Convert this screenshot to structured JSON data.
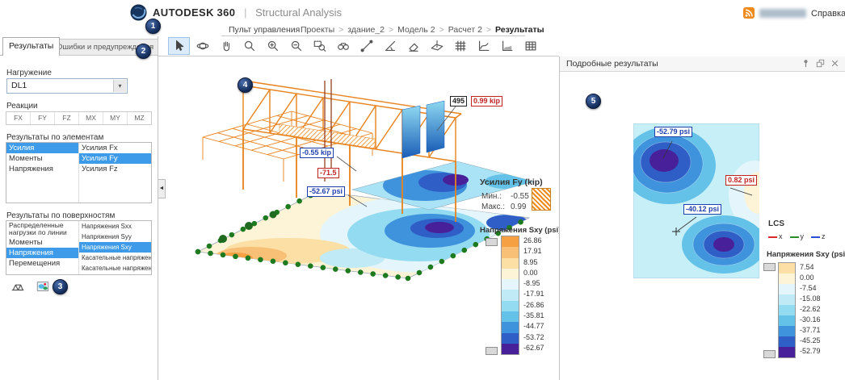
{
  "header": {
    "brand": "AUTODESK",
    "brand_sup": "360",
    "divider": "|",
    "app_title": "Structural Analysis",
    "help_link": "Справка",
    "nav_home": "Пульт управления",
    "breadcrumb_sep": ">",
    "breadcrumbs": [
      "Проекты",
      "здание_2",
      "Модель 2",
      "Расчет 2",
      "Результаты"
    ]
  },
  "tabs": {
    "results": "Результаты",
    "errors": "Ошибки и предупреждения"
  },
  "left_panel": {
    "load_label": "Нагружение",
    "load_value": "DL1",
    "reactions_label": "Реакции",
    "reaction_buttons": [
      "FX",
      "FY",
      "FZ",
      "MX",
      "MY",
      "MZ"
    ],
    "element_results_label": "Результаты по элементам",
    "element_categories": [
      {
        "label": "Усилия",
        "selected": true
      },
      {
        "label": "Моменты",
        "selected": false
      },
      {
        "label": "Напряжения",
        "selected": false
      }
    ],
    "element_items": [
      {
        "label": "Усилия Fx",
        "selected": false
      },
      {
        "label": "Усилия Fy",
        "selected": true
      },
      {
        "label": "Усилия Fz",
        "selected": false
      }
    ],
    "surface_results_label": "Результаты по поверхностям",
    "surface_categories": [
      {
        "label": "Распределенные нагрузки по линии",
        "selected": false
      },
      {
        "label": "Моменты",
        "selected": false
      },
      {
        "label": "Напряжения",
        "selected": true
      },
      {
        "label": "Перемещения",
        "selected": false
      }
    ],
    "surface_items": [
      {
        "label": "Напряжения Sxx",
        "selected": false
      },
      {
        "label": "Напряжения Syy",
        "selected": false
      },
      {
        "label": "Напряжения Sxy",
        "selected": true
      },
      {
        "label": "Касательные напряжения Txx",
        "selected": false
      },
      {
        "label": "Касательные напряжения Tyy",
        "selected": false
      }
    ],
    "footer_icons": [
      {
        "name": "structure-view-icon"
      },
      {
        "name": "result-map-icon"
      }
    ]
  },
  "toolbar": {
    "tools": [
      {
        "name": "select",
        "active": true
      },
      {
        "name": "orbit"
      },
      {
        "name": "pan"
      },
      {
        "name": "zoom"
      },
      {
        "name": "zoom-in"
      },
      {
        "name": "zoom-out"
      },
      {
        "name": "zoom-window"
      },
      {
        "name": "find"
      },
      {
        "name": "measure-line"
      },
      {
        "name": "measure-angle"
      },
      {
        "name": "eraser"
      },
      {
        "name": "section-plane"
      },
      {
        "name": "grid"
      },
      {
        "name": "chart-line"
      },
      {
        "name": "chart-area"
      },
      {
        "name": "table"
      }
    ]
  },
  "viewport": {
    "node_label": "495",
    "max_force_label": "0.99 kip",
    "min_force_label": "-0.55 kip",
    "mid_stress_label": "-71.5",
    "min_stress_label": "-52.67 psi",
    "force_legend": {
      "title": "Усилия Fy (kip)",
      "min_label": "Мин.:",
      "min_value": "-0.55",
      "max_label": "Макс.:",
      "max_value": "0.99"
    },
    "stress_legend": {
      "title": "Напряжения Sxy (psi)",
      "entries": [
        {
          "value": "26.86",
          "color": "#F5A143"
        },
        {
          "value": "17.91",
          "color": "#F8BF77"
        },
        {
          "value": "8.95",
          "color": "#FBDFA5"
        },
        {
          "value": "0.00",
          "color": "#FDF3D7"
        },
        {
          "value": "-8.95",
          "color": "#E4F6FB"
        },
        {
          "value": "-17.91",
          "color": "#BFEAF6"
        },
        {
          "value": "-26.86",
          "color": "#93DBF0"
        },
        {
          "value": "-35.81",
          "color": "#64C2E8"
        },
        {
          "value": "-44.77",
          "color": "#3F92DC"
        },
        {
          "value": "-53.72",
          "color": "#2F5FC6"
        },
        {
          "value": "-62.67",
          "color": "#482099"
        }
      ]
    }
  },
  "detail_panel": {
    "title": "Подробные результаты",
    "min_label_1": "-52.79 psi",
    "max_label": "0.82 psi",
    "min_label_2": "-40.12 psi",
    "window_icons": [
      {
        "name": "pin-icon"
      },
      {
        "name": "popout-icon"
      },
      {
        "name": "close-icon"
      }
    ],
    "lcs": {
      "title": "LCS",
      "axes": [
        {
          "name": "x",
          "color": "#D42A2A"
        },
        {
          "name": "y",
          "color": "#2A8F2A"
        },
        {
          "name": "z",
          "color": "#2A50D4"
        }
      ]
    },
    "stress_legend": {
      "title": "Напряжения Sxy (psi)",
      "entries": [
        {
          "value": "7.54",
          "color": "#FBDFA5"
        },
        {
          "value": "0.00",
          "color": "#FDF3D7"
        },
        {
          "value": "-7.54",
          "color": "#E4F6FB"
        },
        {
          "value": "-15.08",
          "color": "#BFEAF6"
        },
        {
          "value": "-22.62",
          "color": "#93DBF0"
        },
        {
          "value": "-30.16",
          "color": "#64C2E8"
        },
        {
          "value": "-37.71",
          "color": "#3F92DC"
        },
        {
          "value": "-45.25",
          "color": "#2F5FC6"
        },
        {
          "value": "-52.79",
          "color": "#482099"
        }
      ]
    }
  },
  "callouts": [
    "1",
    "2",
    "3",
    "4",
    "5"
  ]
}
